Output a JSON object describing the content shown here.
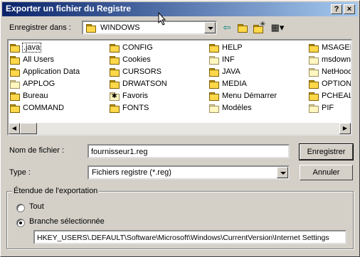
{
  "window": {
    "title": "Exporter un fichier du Registre",
    "help_button": "?",
    "close_button": "×"
  },
  "save_in": {
    "label": "Enregistrer dans :",
    "value": "WINDOWS",
    "icons": [
      "folder-icon",
      "back-arrow-icon",
      "up-folder-icon",
      "new-folder-icon",
      "view-menu-icon"
    ]
  },
  "files": [
    {
      "name": ".java",
      "icon": "folder",
      "selected": true
    },
    {
      "name": "All Users",
      "icon": "folder"
    },
    {
      "name": "Application Data",
      "icon": "folder"
    },
    {
      "name": "APPLOG",
      "icon": "folder-pale"
    },
    {
      "name": "Bureau",
      "icon": "folder"
    },
    {
      "name": "COMMAND",
      "icon": "folder"
    },
    {
      "name": "CONFIG",
      "icon": "folder"
    },
    {
      "name": "Cookies",
      "icon": "folder"
    },
    {
      "name": "CURSORS",
      "icon": "folder"
    },
    {
      "name": "DRWATSON",
      "icon": "folder"
    },
    {
      "name": "Favoris",
      "icon": "favorites-folder"
    },
    {
      "name": "FONTS",
      "icon": "folder"
    },
    {
      "name": "HELP",
      "icon": "folder"
    },
    {
      "name": "INF",
      "icon": "folder-pale"
    },
    {
      "name": "JAVA",
      "icon": "folder"
    },
    {
      "name": "MEDIA",
      "icon": "folder"
    },
    {
      "name": "Menu Démarrer",
      "icon": "folder"
    },
    {
      "name": "Modèles",
      "icon": "folder-pale"
    },
    {
      "name": "MSAGEN",
      "icon": "folder"
    },
    {
      "name": "msdownl",
      "icon": "folder-pale"
    },
    {
      "name": "NetHood",
      "icon": "folder-pale"
    },
    {
      "name": "OPTION",
      "icon": "folder"
    },
    {
      "name": "PCHEAL",
      "icon": "folder"
    },
    {
      "name": "PIF",
      "icon": "folder-pale"
    }
  ],
  "filename": {
    "label": "Nom de fichier :",
    "value": "fournisseur1.reg"
  },
  "filetype": {
    "label": "Type :",
    "value": "Fichiers registre (*.reg)"
  },
  "buttons": {
    "save": "Enregistrer",
    "cancel": "Annuler"
  },
  "export_range": {
    "title": "Étendue de l'exportation",
    "all_label": "Tout",
    "branch_label": "Branche sélectionnée",
    "branch_value": "HKEY_USERS\\.DEFAULT\\Software\\Microsoft\\Windows\\CurrentVersion\\Internet Settings",
    "selected": "branch"
  }
}
